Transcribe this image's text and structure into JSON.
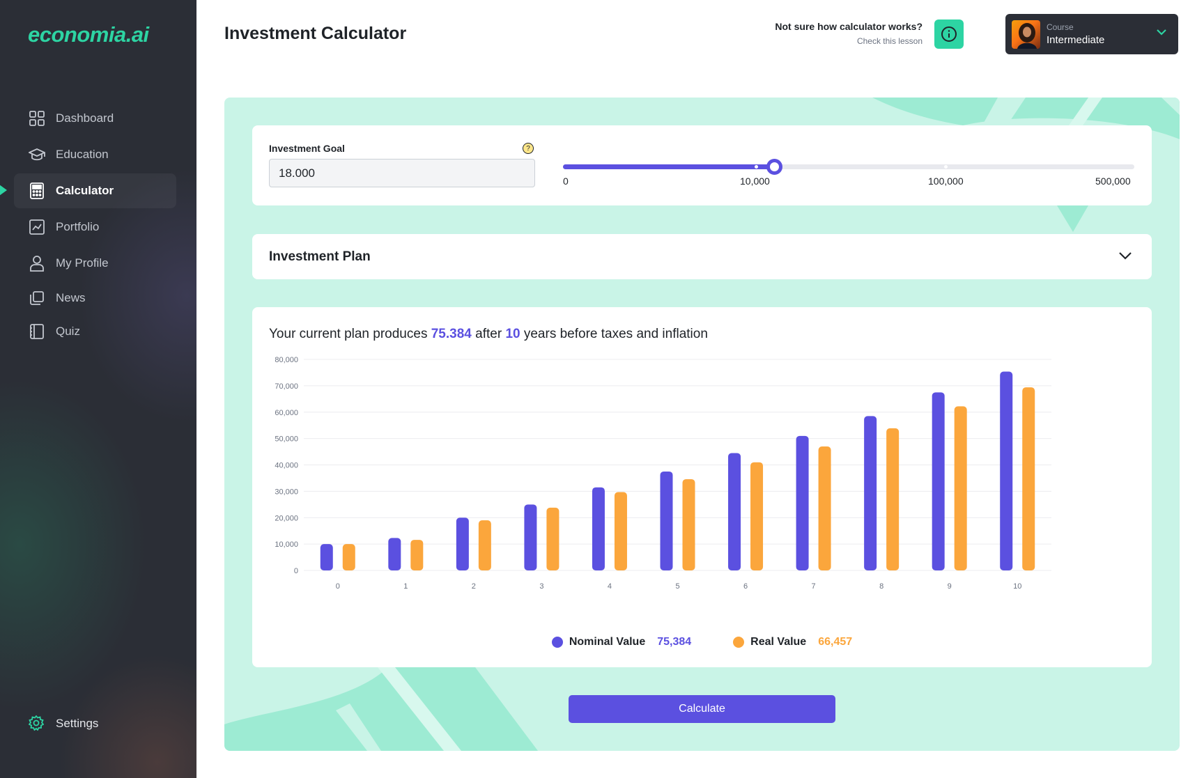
{
  "app": {
    "logo": "economia.ai",
    "page_title": "Investment Calculator"
  },
  "sidebar": {
    "items": [
      {
        "label": "Dashboard",
        "icon": "grid-icon"
      },
      {
        "label": "Education",
        "icon": "graduation-cap-icon"
      },
      {
        "label": "Calculator",
        "icon": "calculator-icon",
        "active": true
      },
      {
        "label": "Portfolio",
        "icon": "chart-icon"
      },
      {
        "label": "My Profile",
        "icon": "user-icon"
      },
      {
        "label": "News",
        "icon": "copy-icon"
      },
      {
        "label": "Quiz",
        "icon": "book-icon"
      }
    ],
    "settings_label": "Settings"
  },
  "header": {
    "help_question": "Not sure how calculator works?",
    "help_link": "Check this lesson",
    "course_label": "Course",
    "course_value": "Intermediate"
  },
  "goal": {
    "label": "Investment Goal",
    "value": "18.000",
    "slider_labels": [
      "0",
      "10,000",
      "100,000",
      "500,000"
    ]
  },
  "plan": {
    "title": "Investment Plan"
  },
  "summary": {
    "prefix": "Your current plan produces ",
    "amount": "75.384",
    "middle": " after ",
    "years": "10",
    "suffix": " years before taxes and inflation"
  },
  "colors": {
    "nominal": "#5b50e0",
    "real": "#fba63c",
    "accent": "#2dd4a3"
  },
  "chart_data": {
    "type": "bar",
    "categories": [
      "0",
      "1",
      "2",
      "3",
      "4",
      "5",
      "6",
      "7",
      "8",
      "9",
      "10"
    ],
    "series": [
      {
        "name": "Nominal Value",
        "values": [
          10000,
          12300,
          20000,
          25000,
          31500,
          37500,
          44500,
          51000,
          58500,
          67500,
          75384
        ],
        "color": "#5b50e0"
      },
      {
        "name": "Real Value",
        "values": [
          10000,
          11600,
          19000,
          23800,
          29700,
          34600,
          41000,
          47000,
          53900,
          62200,
          69400
        ],
        "color": "#fba63c"
      }
    ],
    "ylim": [
      0,
      80000
    ],
    "yticks": [
      "0",
      "10,000",
      "20,000",
      "30,000",
      "40,000",
      "50,000",
      "60,000",
      "70,000",
      "80,000"
    ],
    "grid": true,
    "legend": "bottom-center"
  },
  "legend": {
    "nominal_name": "Nominal Value",
    "nominal_value": "75,384",
    "real_name": "Real Value",
    "real_value": "66,457"
  },
  "actions": {
    "calculate_label": "Calculate"
  }
}
